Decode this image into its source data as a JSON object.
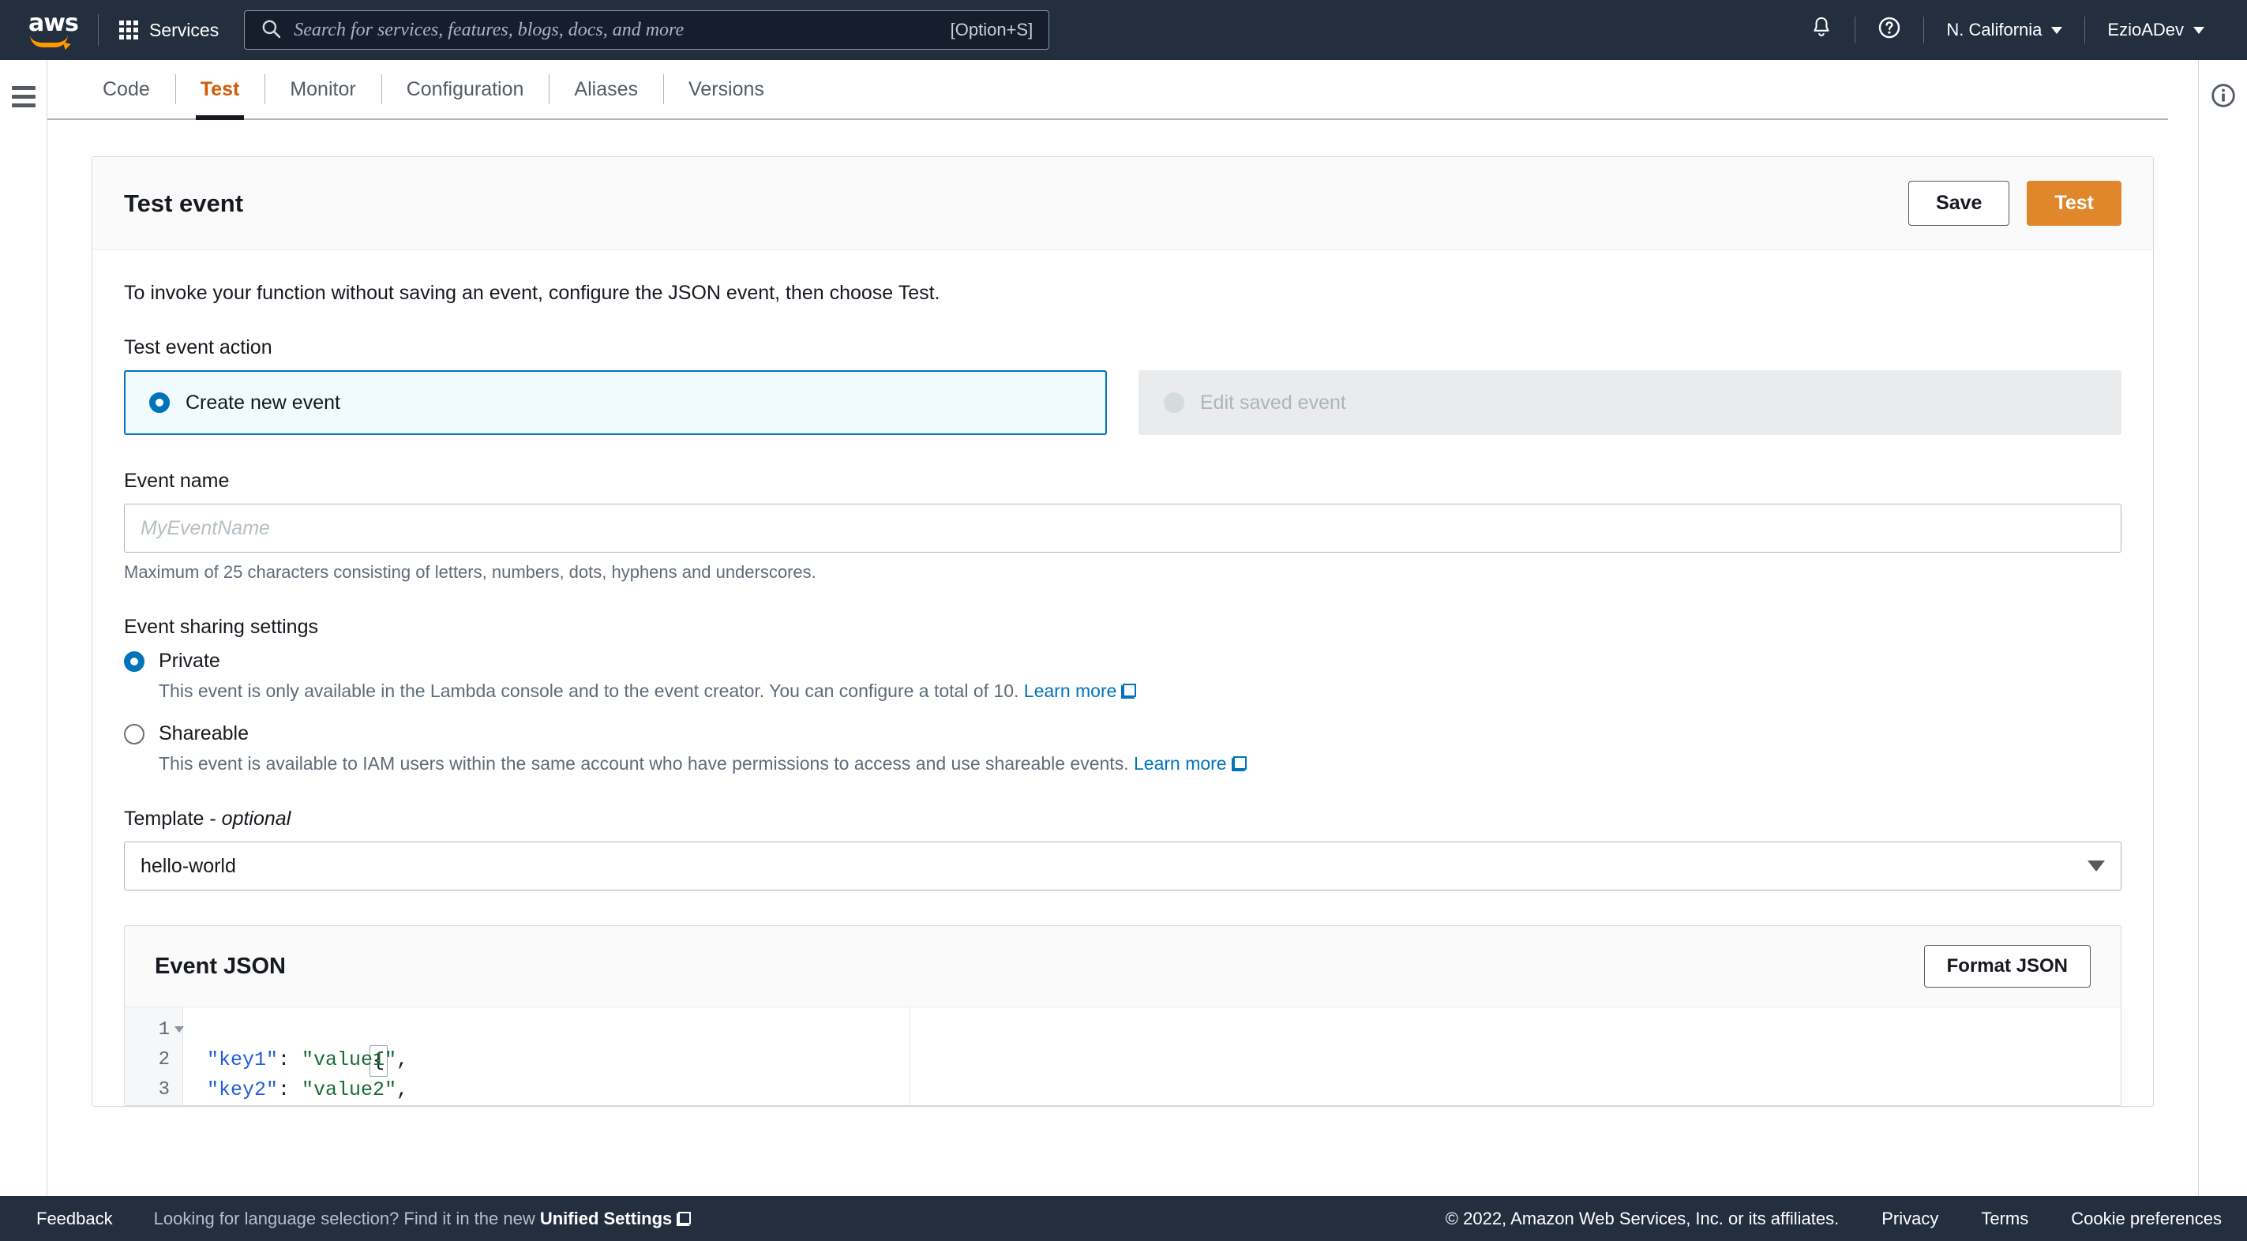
{
  "topnav": {
    "logo_text": "aws",
    "services_label": "Services",
    "search": {
      "placeholder": "Search for services, features, blogs, docs, and more",
      "shortcut": "[Option+S]",
      "icon": "search-icon"
    },
    "notifications_icon": "bell-icon",
    "help_icon": "question-circle-icon",
    "region": "N. California",
    "account": "EzioADev"
  },
  "tabs": [
    {
      "label": "Code",
      "active": false
    },
    {
      "label": "Test",
      "active": true
    },
    {
      "label": "Monitor",
      "active": false
    },
    {
      "label": "Configuration",
      "active": false
    },
    {
      "label": "Aliases",
      "active": false
    },
    {
      "label": "Versions",
      "active": false
    }
  ],
  "card": {
    "title": "Test event",
    "save_label": "Save",
    "test_label": "Test",
    "description": "To invoke your function without saving an event, configure the JSON event, then choose Test."
  },
  "test_event_action": {
    "label": "Test event action",
    "options": [
      {
        "label": "Create new event",
        "selected": true,
        "disabled": false
      },
      {
        "label": "Edit saved event",
        "selected": false,
        "disabled": true
      }
    ]
  },
  "event_name": {
    "label": "Event name",
    "value": "",
    "placeholder": "MyEventName",
    "hint": "Maximum of 25 characters consisting of letters, numbers, dots, hyphens and underscores."
  },
  "sharing": {
    "label": "Event sharing settings",
    "options": [
      {
        "label": "Private",
        "selected": true,
        "description": "This event is only available in the Lambda console and to the event creator. You can configure a total of 10.",
        "link": "Learn more"
      },
      {
        "label": "Shareable",
        "selected": false,
        "description": "This event is available to IAM users within the same account who have permissions to access and use shareable events.",
        "link": "Learn more"
      }
    ]
  },
  "template": {
    "label_main": "Template - ",
    "label_optional": "optional",
    "value": "hello-world"
  },
  "event_json": {
    "title": "Event JSON",
    "format_label": "Format JSON",
    "lines": [
      {
        "num": "1",
        "foldable": true,
        "brace": "{"
      },
      {
        "num": "2",
        "foldable": false,
        "key": "\"key1\"",
        "sep": ": ",
        "val": "\"value1\"",
        "tail": ","
      },
      {
        "num": "3",
        "foldable": false,
        "key": "\"key2\"",
        "sep": ": ",
        "val": "\"value2\"",
        "tail": ","
      }
    ]
  },
  "info_icon": "info-circle-icon",
  "menu_icon": "hamburger-menu-icon",
  "footer": {
    "feedback": "Feedback",
    "language_prefix": "Looking for language selection? Find it in the new ",
    "language_link": "Unified Settings",
    "copyright": "© 2022, Amazon Web Services, Inc. or its affiliates.",
    "links": [
      "Privacy",
      "Terms",
      "Cookie preferences"
    ]
  },
  "colors": {
    "nav_bg": "#232f3e",
    "accent_orange": "#e0872c",
    "active_tab": "#d45b07",
    "link_blue": "#0073bb",
    "logo_smile": "#ff9900"
  }
}
